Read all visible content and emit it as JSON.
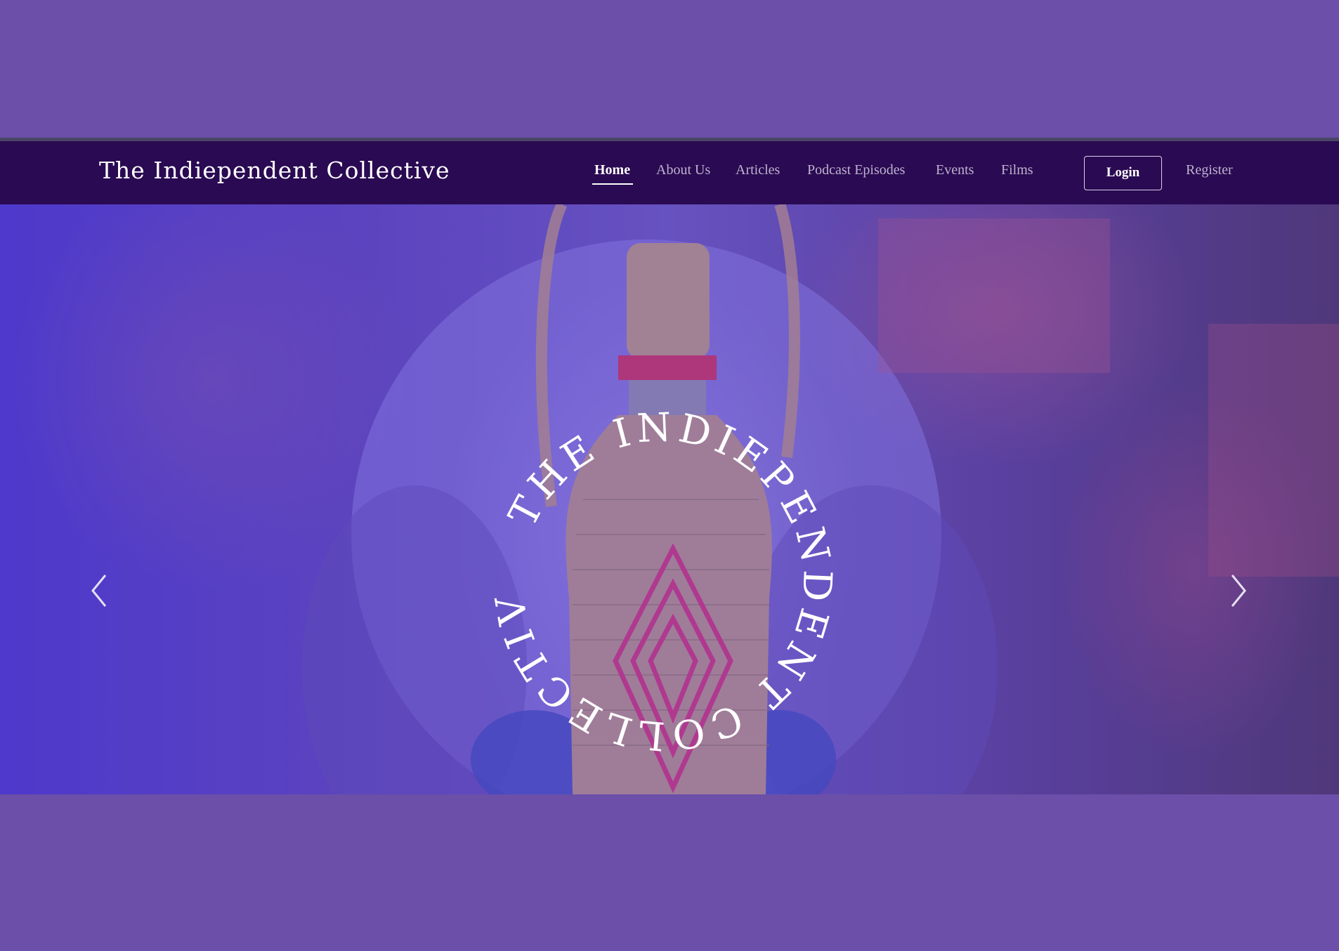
{
  "site": {
    "brand": "The Indiependent Collective"
  },
  "nav": {
    "items": [
      {
        "label": "Home",
        "active": true
      },
      {
        "label": "About Us",
        "active": false
      },
      {
        "label": "Articles",
        "active": false
      },
      {
        "label": "Podcast Episodes",
        "active": false
      },
      {
        "label": "Events",
        "active": false
      },
      {
        "label": "Films",
        "active": false
      }
    ],
    "login_label": "Login",
    "register_label": "Register"
  },
  "hero": {
    "circular_text": "THE INDIEPENDENT COLLECTIVE",
    "prev_icon": "chevron-left-icon",
    "next_icon": "chevron-right-icon"
  },
  "colors": {
    "page_background": "#6b4fa8",
    "navbar_background": "#2a0a52",
    "nav_text": "#bdb3cf",
    "nav_active": "#ffffff"
  }
}
